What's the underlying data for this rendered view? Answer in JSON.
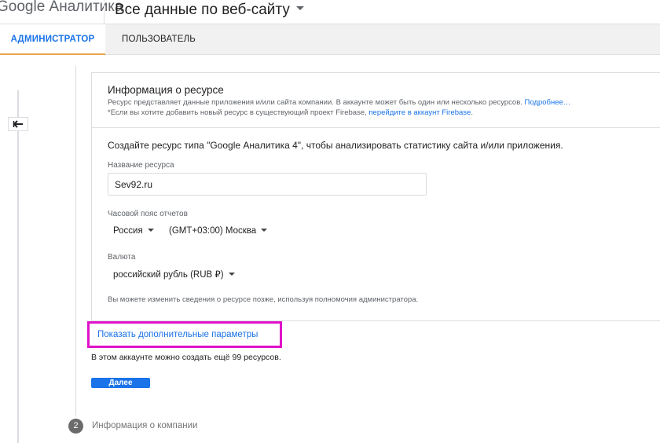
{
  "app": {
    "brand": "Google Аналитика",
    "account_name": "Все данные по веб-сайту"
  },
  "tabs": [
    {
      "label": "АДМИНИСТРАТОР",
      "active": true
    },
    {
      "label": "ПОЛЬЗОВАТЕЛЬ",
      "active": false
    }
  ],
  "resource_info": {
    "title": "Информация о ресурсе",
    "description": "Ресурс представляет данные приложения и/или сайта компании. В аккаунте может быть один или несколько ресурсов.",
    "more_link": "Подробнее…",
    "firebase_note": "*Если вы хотите добавить новый ресурс в существующий проект Firebase,",
    "firebase_link": "перейдите в аккаунт Firebase",
    "firebase_tail": "."
  },
  "form": {
    "intro": "Создайте ресурс типа \"Google Аналитика 4\", чтобы анализировать статистику сайта и/или приложения.",
    "name_label": "Название ресурса",
    "name_value": "Sev92.ru",
    "timezone_label": "Часовой пояс отчетов",
    "country": "Россия",
    "timezone": "(GMT+03:00) Москва",
    "currency_label": "Валюта",
    "currency": "российский рубль (RUB ₽)",
    "note": "Вы можете изменить сведения о ресурсе позже, используя полномочия администратора."
  },
  "advanced_link": "Показать дополнительные параметры",
  "quota_text": "В этом аккаунте можно создать ещё 99 ресурсов.",
  "next_button": "Далее",
  "step2": {
    "number": "2",
    "label": "Информация о компании"
  },
  "colors": {
    "accent": "#1a73e8",
    "highlight": "#e012c8",
    "tab_underline": "#e8a44a"
  },
  "icons": [
    "back-arrow-icon",
    "dropdown-caret-icon"
  ]
}
